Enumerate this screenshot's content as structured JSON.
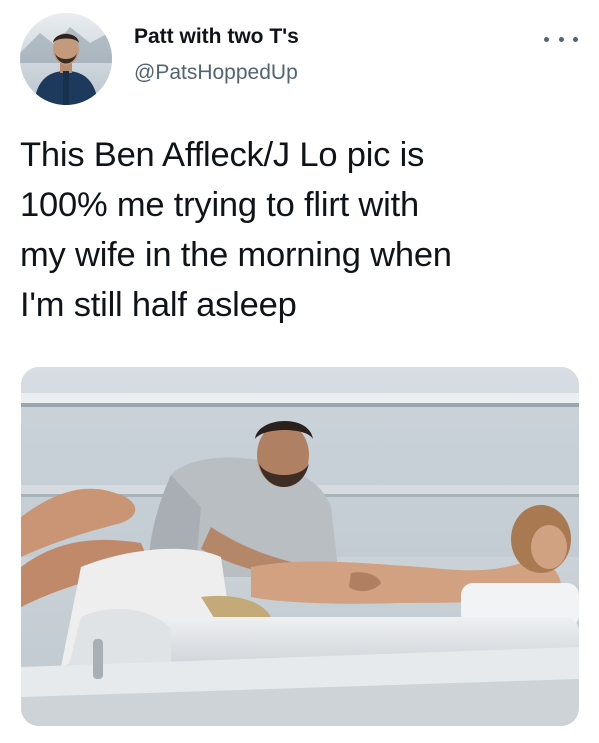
{
  "tweet": {
    "author_name": "Patt with two T's",
    "author_handle": "@PatsHoppedUp",
    "text_lines": [
      "This Ben Affleck/J Lo pic is",
      "100% me trying to flirt with",
      "my wife in the morning when",
      "I'm still half asleep"
    ],
    "more_icon": "more-horizontal-icon",
    "media": {
      "kind": "photo",
      "description_icon": "photo-image"
    }
  },
  "colors": {
    "text_primary": "#0f1419",
    "text_secondary": "#536471",
    "background": "#ffffff"
  }
}
